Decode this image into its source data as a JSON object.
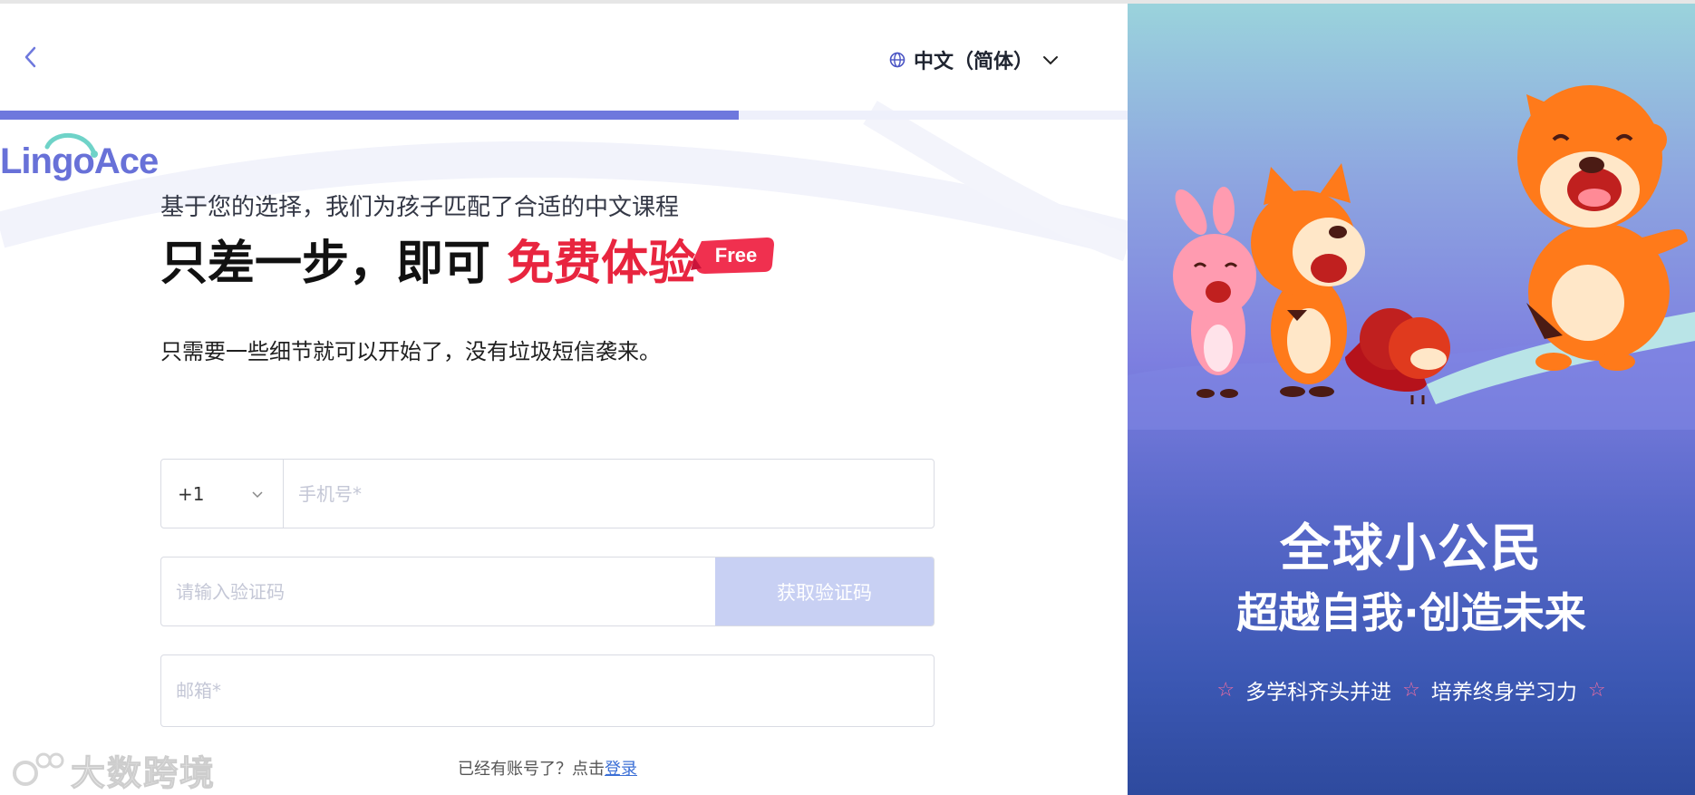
{
  "header": {
    "back_label": "back",
    "language": "中文（简体）"
  },
  "progress": {
    "percent": 65.5
  },
  "brand": {
    "logo_text": "LingoAce"
  },
  "hero": {
    "subtitle": "基于您的选择，我们为孩子匹配了合适的中文课程",
    "headline_black": "只差一步，即可 ",
    "headline_red": "免费体验",
    "badge": "Free",
    "description": "只需要一些细节就可以开始了，没有垃圾短信袭来。"
  },
  "form": {
    "country_code": "+1",
    "phone_placeholder": "手机号*",
    "code_placeholder": "请输入验证码",
    "get_code_label": "获取验证码",
    "email_placeholder": "邮箱*"
  },
  "login": {
    "prompt": "已经有账号了？点击",
    "link": "登录"
  },
  "watermark": {
    "text": "大数跨境"
  },
  "promo": {
    "title": "全球小公民",
    "subtitle": "超越自我·创造未来",
    "star": "☆",
    "feature1": "多学科齐头并进",
    "feature2": "培养终身学习力"
  },
  "colors": {
    "accent": "#6e78dd",
    "red": "#e8253f",
    "button_disabled": "#c8d0f3"
  }
}
